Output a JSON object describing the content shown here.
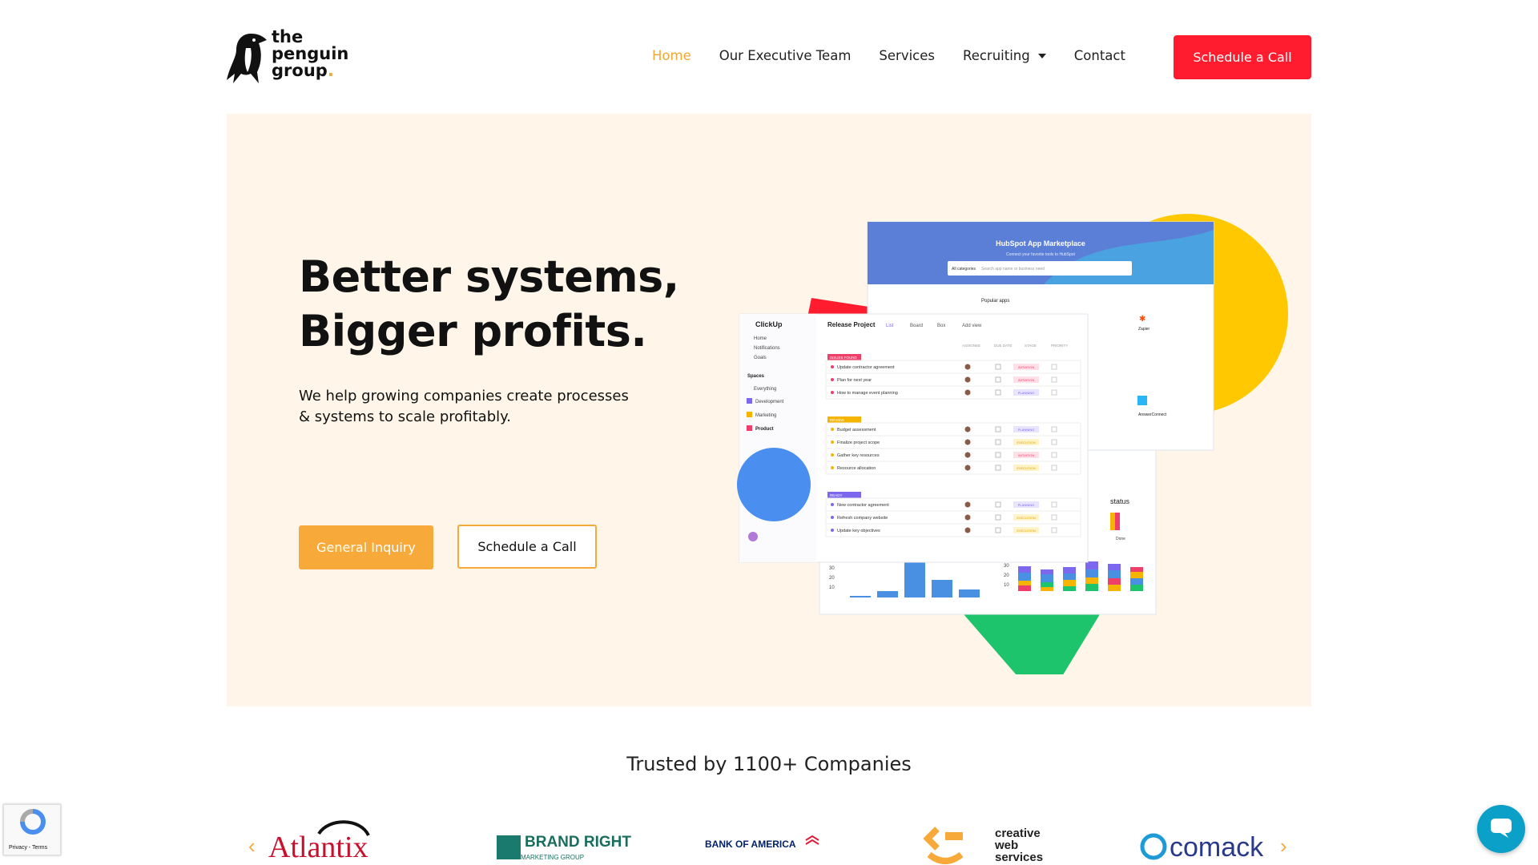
{
  "brand": {
    "line1": "the",
    "line2": "penguin",
    "line3": "group",
    "dot": "."
  },
  "nav": [
    {
      "label": "Home",
      "active": true
    },
    {
      "label": "Our Executive Team",
      "active": false
    },
    {
      "label": "Services",
      "active": false
    },
    {
      "label": "Recruiting",
      "active": false,
      "dropdown": true
    },
    {
      "label": "Contact",
      "active": false
    }
  ],
  "header_cta": "Schedule a Call",
  "hero": {
    "title_line1": "Better systems,",
    "title_line2": "Bigger profits.",
    "subtitle": "We help growing companies create processes & systems to scale profitably.",
    "btn_inquiry": "General Inquiry",
    "btn_call": "Schedule a Call"
  },
  "mockup": {
    "hubspot": {
      "title": "HubSpot App Marketplace",
      "subtitle": "Connect your favorite tools to HubSpot",
      "search_placeholder": "Search app name or business need",
      "category": "All categories",
      "popular": "Popular apps",
      "zapier": "Zapier",
      "answerconnect": "AnswerConnect"
    },
    "clickup": {
      "brand": "ClickUp",
      "nav": [
        "Home",
        "Notifications",
        "Goals"
      ],
      "spaces_label": "Spaces",
      "spaces": [
        "Everything",
        "Development",
        "Marketing",
        "Product"
      ],
      "project": "Release Project",
      "views": [
        "List",
        "Board",
        "Box",
        "Add view"
      ],
      "columns": [
        "ASSIGNEE",
        "DUE DATE",
        "STAGE",
        "PRIORITY"
      ],
      "groups": [
        {
          "label": "ISSUES FOUND",
          "color": "#f03e6a",
          "tasks": [
            {
              "name": "Update contractor agreement",
              "stage": "INITIATION"
            },
            {
              "name": "Plan for next year",
              "stage": "INITIATION"
            },
            {
              "name": "How to manage event planning",
              "stage": "PLANNING"
            }
          ]
        },
        {
          "label": "REVIEW",
          "color": "#f5b400",
          "tasks": [
            {
              "name": "Budget assessment",
              "stage": "PLANNING"
            },
            {
              "name": "Finalize project scope",
              "stage": "EXECUTION"
            },
            {
              "name": "Gather key resources",
              "stage": "INITIATION"
            },
            {
              "name": "Resource allocation",
              "stage": "EXECUTION"
            }
          ]
        },
        {
          "label": "READY",
          "color": "#7b68ee",
          "tasks": [
            {
              "name": "New contractor agreement",
              "stage": "PLANNING"
            },
            {
              "name": "Refresh company website",
              "stage": "EXECUTION"
            },
            {
              "name": "Update key objectives",
              "stage": "EXECUTION"
            }
          ]
        }
      ],
      "status_label": "status",
      "done_label": "Done"
    }
  },
  "trusted": "Trusted by 1100+ Companies",
  "logos": [
    "Atlantix",
    "BRAND RIGHT",
    "MARKETING GROUP",
    "BANK OF AMERICA",
    "creative",
    "web",
    "services",
    "comack"
  ],
  "recaptcha": "Privacy - Terms",
  "colors": {
    "accent": "#f7a93a",
    "cta": "#ff1c2e",
    "hero_bg": "#fff6e9"
  }
}
